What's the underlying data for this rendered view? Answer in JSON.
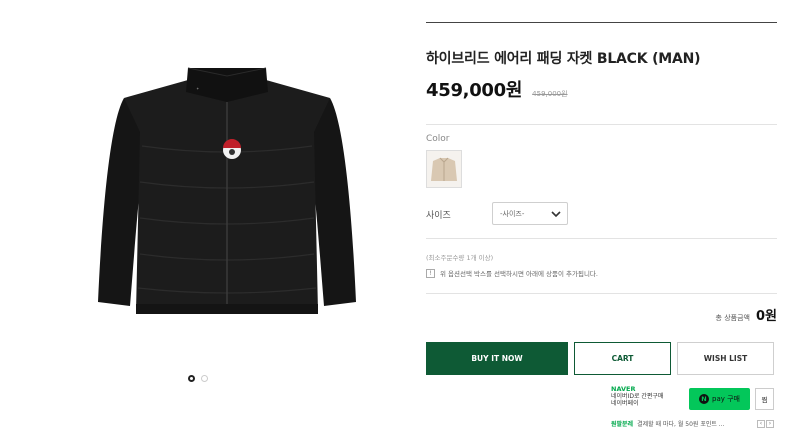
{
  "product": {
    "title": "하이브리드 에어리 패딩 자켓 BLACK (MAN)",
    "price": "459,000원",
    "original_price": "459,000원"
  },
  "gallery": {
    "slide_count": 2,
    "active_slide": 1
  },
  "options": {
    "color_label": "Color",
    "size_label": "사이즈",
    "size_selected": "-사이즈-",
    "min_qty_note": "(최소주문수량 1개 이상)",
    "option_hint": "위 옵션선택 박스를 선택하시면 아래에 상품이 추가됩니다."
  },
  "total": {
    "label": "총 상품금액",
    "value": "0원"
  },
  "buttons": {
    "buy_now": "BUY IT NOW",
    "cart": "CART",
    "wish_list": "WISH LIST"
  },
  "naver_pay": {
    "brand": "NAVER",
    "line1": "네이버ID로 간편구매",
    "line2": "네이버페이",
    "pay_label": "pay 구매",
    "wish_label": "찜",
    "event_tag": "원팔분레",
    "event_text": "결제할 때 마다, 월 50원 포인트 ..."
  },
  "colors": {
    "primary_green": "#0e5a35",
    "naver_green": "#03c75a"
  },
  "icons": {
    "chevron": "chevron-down-icon",
    "hint": "info-icon"
  }
}
